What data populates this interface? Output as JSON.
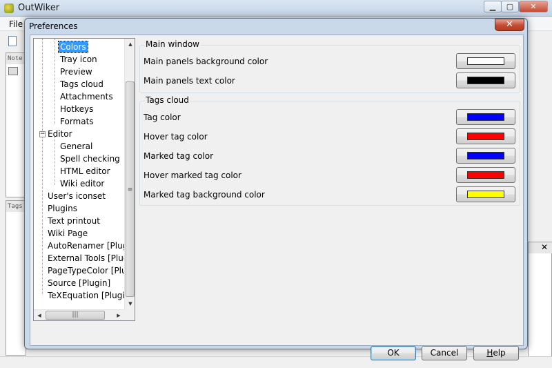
{
  "main_window": {
    "title": "OutWiker",
    "menu_file": "File",
    "notes_header": "Note",
    "tags_header": "Tags",
    "right_close": "✕",
    "minimize": "▁",
    "maximize": "▢",
    "close": "✕"
  },
  "dialog": {
    "title": "Preferences",
    "close": "✕"
  },
  "tree": {
    "items": [
      {
        "label": "Colors"
      },
      {
        "label": "Tray icon"
      },
      {
        "label": "Preview"
      },
      {
        "label": "Tags cloud"
      },
      {
        "label": "Attachments"
      },
      {
        "label": "Hotkeys"
      },
      {
        "label": "Formats"
      },
      {
        "label": "Editor"
      },
      {
        "label": "General"
      },
      {
        "label": "Spell checking"
      },
      {
        "label": "HTML editor"
      },
      {
        "label": "Wiki editor"
      },
      {
        "label": "User's iconset"
      },
      {
        "label": "Plugins"
      },
      {
        "label": "Text printout"
      },
      {
        "label": "Wiki Page"
      },
      {
        "label": "AutoRenamer [Plugin]"
      },
      {
        "label": "External Tools [Plugin]"
      },
      {
        "label": "PageTypeColor [Plugin]"
      },
      {
        "label": "Source [Plugin]"
      },
      {
        "label": "TeXEquation [Plugin]"
      }
    ],
    "expander_minus": "−",
    "scroll_up": "▲",
    "scroll_down": "▼",
    "scroll_left": "◀",
    "scroll_right": "▶",
    "grip": "≡",
    "hgrip": "|||"
  },
  "main_window_group": {
    "label": "Main window",
    "rows": [
      {
        "label": "Main panels background color",
        "color": "#ffffff"
      },
      {
        "label": "Main panels text color",
        "color": "#000000"
      }
    ]
  },
  "tags_cloud_group": {
    "label": "Tags cloud",
    "rows": [
      {
        "label": "Tag color",
        "color": "#0000ff"
      },
      {
        "label": "Hover tag color",
        "color": "#ff0000"
      },
      {
        "label": "Marked tag color",
        "color": "#0000ff"
      },
      {
        "label": "Hover marked tag color",
        "color": "#ff0000"
      },
      {
        "label": "Marked tag background color",
        "color": "#ffff00"
      }
    ]
  },
  "buttons": {
    "ok": "OK",
    "cancel": "Cancel",
    "help": "Help"
  }
}
